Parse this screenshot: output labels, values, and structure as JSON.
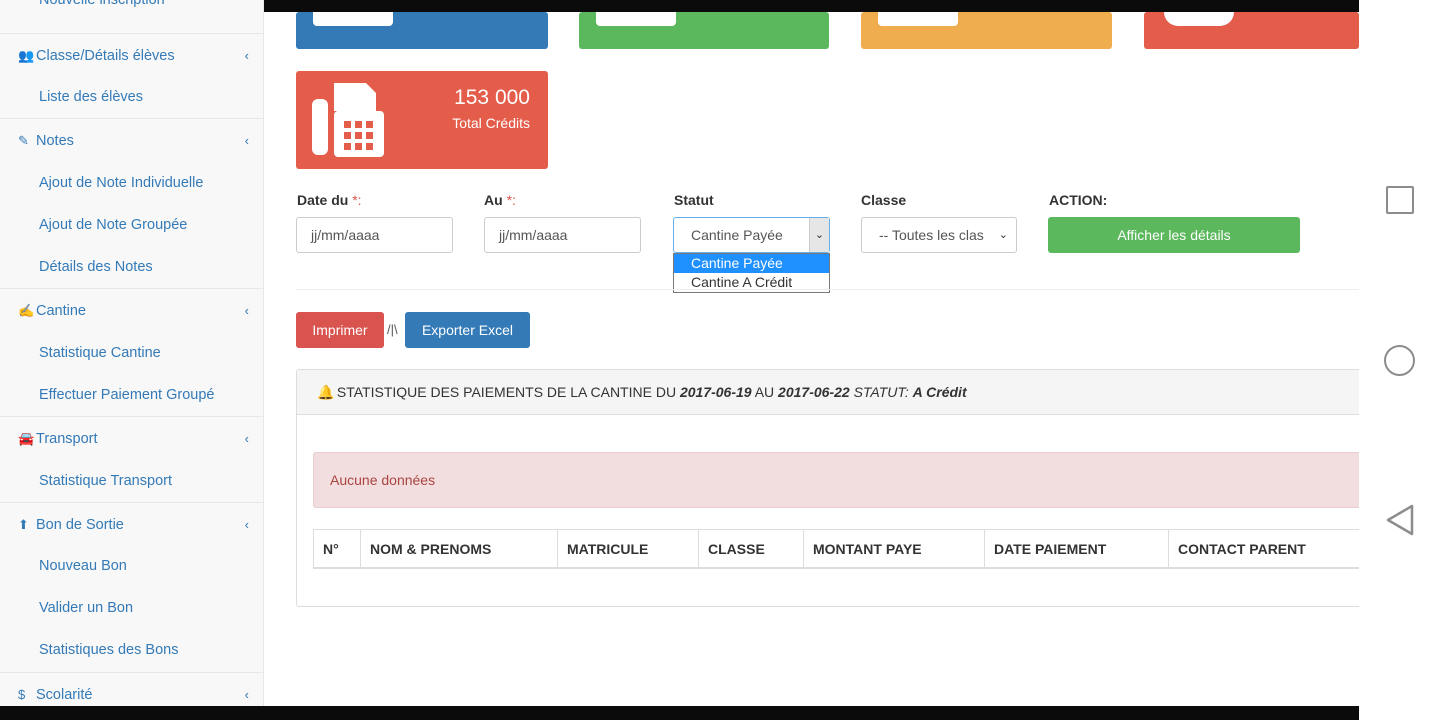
{
  "sidebar": {
    "partial_top": "Nouvelle inscription",
    "items": [
      {
        "type": "main",
        "icon": "users-icon",
        "glyph": "👥",
        "label": "Classe/Détails élèves"
      },
      {
        "type": "sub",
        "label": "Liste des élèves"
      },
      {
        "type": "main",
        "icon": "pencil-icon",
        "glyph": "✎",
        "label": "Notes"
      },
      {
        "type": "sub",
        "label": "Ajout de Note Individuelle"
      },
      {
        "type": "sub",
        "label": "Ajout de Note Groupée"
      },
      {
        "type": "sub",
        "label": "Détails des Notes"
      },
      {
        "type": "main",
        "icon": "edit-icon",
        "glyph": "✍",
        "label": "Cantine"
      },
      {
        "type": "sub",
        "label": "Statistique Cantine"
      },
      {
        "type": "sub",
        "label": "Effectuer Paiement Groupé"
      },
      {
        "type": "main",
        "icon": "car-icon",
        "glyph": "🚘",
        "label": "Transport"
      },
      {
        "type": "sub",
        "label": "Statistique Transport"
      },
      {
        "type": "main",
        "icon": "upload-icon",
        "glyph": "⬆",
        "label": "Bon de Sortie"
      },
      {
        "type": "sub",
        "label": "Nouveau Bon"
      },
      {
        "type": "sub",
        "label": "Valider un Bon"
      },
      {
        "type": "sub",
        "label": "Statistiques des Bons"
      },
      {
        "type": "main",
        "icon": "dollar-icon",
        "glyph": "$",
        "label": "Scolarité"
      }
    ],
    "chevron": "‹"
  },
  "credit_tile": {
    "value": "153 000",
    "label": "Total Crédits",
    "icon": "fax-icon"
  },
  "filters": {
    "date_from_label": "Date du",
    "date_to_label": "Au",
    "required_mark": "*:",
    "date_placeholder": "jj/mm/aaaa",
    "status_label": "Statut",
    "status_value": "Cantine Payée",
    "status_options": [
      "Cantine Payée",
      "Cantine A Crédit"
    ],
    "class_label": "Classe",
    "class_value": "-- Toutes les clas",
    "action_label": "ACTION:",
    "details_button": "Afficher les détails"
  },
  "toolbar": {
    "print_button": "Imprimer",
    "separator": "/|\\",
    "export_button": "Exporter Excel"
  },
  "panel": {
    "prefix": "STATISTIQUE DES PAIEMENTS DE LA CANTINE DU",
    "date_from": "2017-06-19",
    "middle": "AU",
    "date_to": "2017-06-22",
    "status_prefix": "STATUT:",
    "status": "A Crédit",
    "empty_message": "Aucune données"
  },
  "table": {
    "headers": [
      "N°",
      "NOM & PRENOMS",
      "MATRICULE",
      "CLASSE",
      "MONTANT PAYE",
      "DATE PAIEMENT",
      "CONTACT PARENT"
    ]
  },
  "colors": {
    "primary": "#337ab7",
    "success": "#5cb85c",
    "warning": "#f0ad4e",
    "danger": "#e45c4a",
    "alert_bg": "#f2dede",
    "alert_text": "#a94442"
  }
}
